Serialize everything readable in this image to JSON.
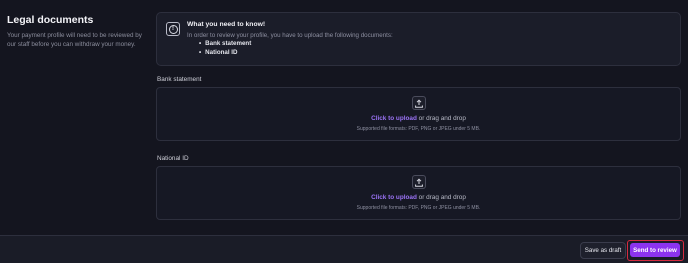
{
  "legal": {
    "title": "Legal documents",
    "description": "Your payment profile will need to be reviewed by our staff before you can withdraw your money."
  },
  "notice": {
    "icon": "info-icon",
    "title": "What you need to know!",
    "text": "In order to review your profile, you have to upload the following documents:",
    "documents": [
      "Bank statement",
      "National ID"
    ]
  },
  "uploads": [
    {
      "label": "Bank statement",
      "icon": "upload-icon",
      "link_text": "Click to upload",
      "rest_text": " or drag and drop",
      "hint": "Supported file formats: PDF, PNG or JPEG under 5 MB."
    },
    {
      "label": "National ID",
      "icon": "upload-icon",
      "link_text": "Click to upload",
      "rest_text": " or drag and drop",
      "hint": "Supported file formats: PDF, PNG or JPEG under 5 MB."
    }
  ],
  "footer": {
    "draft_label": "Save as draft",
    "send_label": "Send to review"
  },
  "colors": {
    "background": "#14151f",
    "accent": "#8c33ef",
    "link": "#9b73f6",
    "highlight_border": "#d52a3e"
  }
}
